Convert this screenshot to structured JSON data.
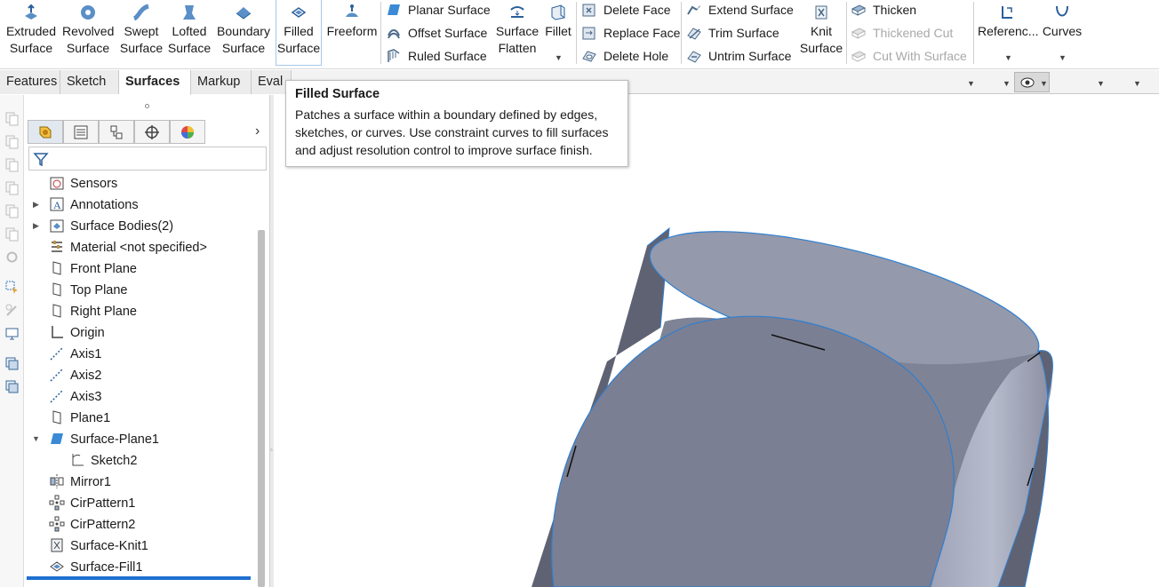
{
  "ribbon": {
    "extruded_surface": "Extruded\nSurface",
    "revolved_surface": "Revolved\nSurface",
    "swept_surface": "Swept\nSurface",
    "lofted_surface": "Lofted\nSurface",
    "boundary_surface": "Boundary\nSurface",
    "filled_surface": "Filled\nSurface",
    "freeform": "Freeform",
    "planar_surface": "Planar Surface",
    "offset_surface": "Offset Surface",
    "ruled_surface": "Ruled Surface",
    "surface_flatten": "Surface\nFlatten",
    "fillet": "Fillet",
    "delete_face": "Delete Face",
    "replace_face": "Replace Face",
    "delete_hole": "Delete Hole",
    "extend_surface": "Extend Surface",
    "trim_surface": "Trim Surface",
    "untrim_surface": "Untrim Surface",
    "knit_surface": "Knit\nSurface",
    "thicken": "Thicken",
    "thickened_cut": "Thickened Cut",
    "cut_with_surface": "Cut With Surface",
    "reference": "Referenc...",
    "curves": "Curves"
  },
  "tabs": [
    {
      "label": "Features"
    },
    {
      "label": "Sketch"
    },
    {
      "label": "Surfaces"
    },
    {
      "label": "Markup"
    },
    {
      "label": "Eval"
    }
  ],
  "tooltip": {
    "title": "Filled Surface",
    "description": "Patches a surface within a boundary defined by edges, sketches, or curves. Use constraint curves to fill surfaces and adjust resolution control to improve surface finish."
  },
  "tree": {
    "items": [
      {
        "label": "Sensors",
        "icon": "sensor-icon"
      },
      {
        "label": "Annotations",
        "icon": "annotation-icon"
      },
      {
        "label": "Surface Bodies(2)",
        "icon": "surface-bodies-icon"
      },
      {
        "label": "Material <not specified>",
        "icon": "material-icon"
      },
      {
        "label": "Front Plane",
        "icon": "plane-icon"
      },
      {
        "label": "Top Plane",
        "icon": "plane-icon"
      },
      {
        "label": "Right Plane",
        "icon": "plane-icon"
      },
      {
        "label": "Origin",
        "icon": "origin-icon"
      },
      {
        "label": "Axis1",
        "icon": "axis-icon"
      },
      {
        "label": "Axis2",
        "icon": "axis-icon"
      },
      {
        "label": "Axis3",
        "icon": "axis-icon"
      },
      {
        "label": "Plane1",
        "icon": "plane-icon"
      },
      {
        "label": "Surface-Plane1",
        "icon": "surface-plane-icon"
      },
      {
        "label": "Sketch2",
        "icon": "sketch-icon"
      },
      {
        "label": "Mirror1",
        "icon": "mirror-icon"
      },
      {
        "label": "CirPattern1",
        "icon": "circular-pattern-icon"
      },
      {
        "label": "CirPattern2",
        "icon": "circular-pattern-icon"
      },
      {
        "label": "Surface-Knit1",
        "icon": "knit-icon"
      },
      {
        "label": "Surface-Fill1",
        "icon": "fill-icon"
      }
    ]
  },
  "colors": {
    "accent": "#1e6fd0",
    "model_face": "#7b7f93",
    "model_top": "#9499ab",
    "model_dark": "#5f6272",
    "edge": "#2f7fd0"
  }
}
